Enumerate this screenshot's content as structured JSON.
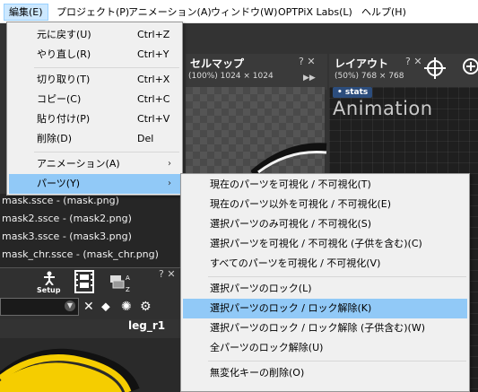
{
  "menubar": {
    "items": [
      {
        "label": "編集(E)",
        "active": true
      },
      {
        "label": "プロジェクト(P)"
      },
      {
        "label": "アニメーション(A)"
      },
      {
        "label": "ウィンドウ(W)"
      },
      {
        "label": "OPTPiX Labs(L)"
      },
      {
        "label": "ヘルプ(H)"
      }
    ]
  },
  "edit_menu": {
    "items": [
      {
        "label": "元に戻す(U)",
        "shortcut": "Ctrl+Z"
      },
      {
        "label": "やり直し(R)",
        "shortcut": "Ctrl+Y"
      },
      {
        "label": "切り取り(T)",
        "shortcut": "Ctrl+X"
      },
      {
        "label": "コピー(C)",
        "shortcut": "Ctrl+C"
      },
      {
        "label": "貼り付け(P)",
        "shortcut": "Ctrl+V"
      },
      {
        "label": "削除(D)",
        "shortcut": "Del"
      },
      {
        "label": "アニメーション(A)",
        "submenu_arrow": "›"
      },
      {
        "label": "パーツ(Y)",
        "submenu_arrow": "›",
        "highlighted": true
      }
    ]
  },
  "parts_menu": {
    "items": [
      {
        "label": "現在のパーツを可視化 / 不可視化(T)"
      },
      {
        "label": "現在のパーツ以外を可視化 / 不可視化(E)"
      },
      {
        "label": "選択パーツのみ可視化 / 不可視化(S)"
      },
      {
        "label": "選択パーツを可視化 / 不可視化 (子供を含む)(C)"
      },
      {
        "label": "すべてのパーツを可視化 / 不可視化(V)"
      },
      {
        "label": "選択パーツのロック(L)"
      },
      {
        "label": "選択パーツのロック / ロック解除(K)",
        "highlighted": true
      },
      {
        "label": "選択パーツのロック / ロック解除 (子供含む)(W)"
      },
      {
        "label": "全パーツのロック解除(U)"
      },
      {
        "label": "無変化キーの削除(O)"
      }
    ]
  },
  "cellmap_panel": {
    "title": "セルマップ",
    "info": "(100%) 1024 × 1024",
    "controls": "? ✕",
    "forward": "▶▶"
  },
  "layout_panel": {
    "title": "レイアウト",
    "info": "(50%) 768 × 768",
    "controls": "? ✕",
    "stats_chip": "• stats",
    "animation_title": "Animation"
  },
  "file_list": {
    "rows": [
      "mask.ssce - (mask.png)",
      "mask2.ssce - (mask2.png)",
      "mask3.ssce - (mask3.png)",
      "mask_chr.ssce - (mask_chr.png)"
    ]
  },
  "bottom_toolbar": {
    "setup_label": "Setup",
    "controls": "? ✕",
    "selected_part": "leg_r1"
  },
  "colors": {
    "menu_bg": "#f0f0f0",
    "menu_highlight": "#91c9f7",
    "menubar_active": "#cce8ff",
    "app_dark": "#333333",
    "accent_yellow": "#f5cd00"
  }
}
